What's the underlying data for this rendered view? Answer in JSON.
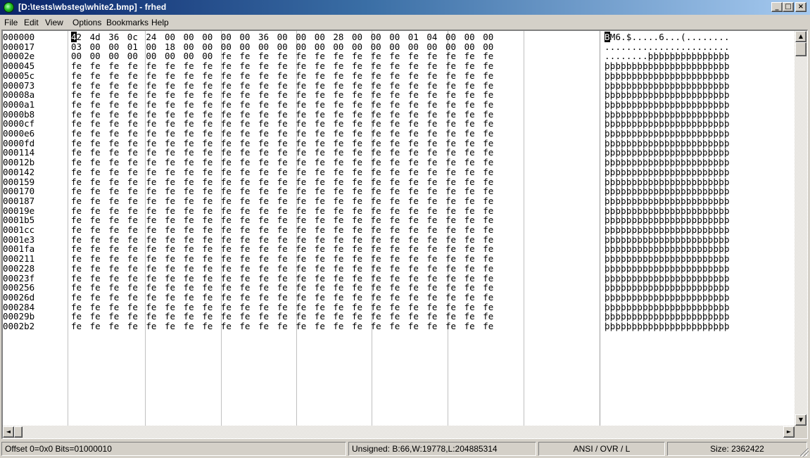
{
  "window": {
    "title": "[D:\\tests\\wbsteg\\white2.bmp] - frhed",
    "minimize_glyph": "_",
    "maximize_glyph": "□",
    "close_glyph": "×"
  },
  "menu": {
    "items": [
      {
        "label": "File",
        "accel": "F"
      },
      {
        "label": "Edit",
        "accel": "E"
      },
      {
        "label": "View",
        "accel": "V"
      },
      {
        "label": "Options",
        "accel": "O"
      },
      {
        "label": "Bookmarks",
        "accel": "B"
      },
      {
        "label": "Help",
        "accel": "H"
      }
    ]
  },
  "hex": {
    "bytes_per_row": 23,
    "cursor": {
      "row": 0,
      "col": 0
    },
    "rows": [
      {
        "offset": "000000",
        "bytes": [
          "42",
          "4d",
          "36",
          "0c",
          "24",
          "00",
          "00",
          "00",
          "00",
          "00",
          "36",
          "00",
          "00",
          "00",
          "28",
          "00",
          "00",
          "00",
          "01",
          "04",
          "00",
          "00",
          "00"
        ],
        "ascii": "BM6.$.....6...(........"
      },
      {
        "offset": "000017",
        "bytes": [
          "03",
          "00",
          "00",
          "01",
          "00",
          "18",
          "00",
          "00",
          "00",
          "00",
          "00",
          "00",
          "00",
          "00",
          "00",
          "00",
          "00",
          "00",
          "00",
          "00",
          "00",
          "00",
          "00"
        ],
        "ascii": "......................."
      },
      {
        "offset": "00002e",
        "bytes": [
          "00",
          "00",
          "00",
          "00",
          "00",
          "00",
          "00",
          "00",
          "fe",
          "fe",
          "fe",
          "fe",
          "fe",
          "fe",
          "fe",
          "fe",
          "fe",
          "fe",
          "fe",
          "fe",
          "fe",
          "fe",
          "fe"
        ],
        "ascii": "........þþþþþþþþþþþþþþþ"
      },
      {
        "offset": "000045",
        "fill": "fe",
        "ascii": "þþþþþþþþþþþþþþþþþþþþþþþ"
      },
      {
        "offset": "00005c",
        "fill": "fe",
        "ascii": "þþþþþþþþþþþþþþþþþþþþþþþ"
      },
      {
        "offset": "000073",
        "fill": "fe",
        "ascii": "þþþþþþþþþþþþþþþþþþþþþþþ"
      },
      {
        "offset": "00008a",
        "fill": "fe",
        "ascii": "þþþþþþþþþþþþþþþþþþþþþþþ"
      },
      {
        "offset": "0000a1",
        "fill": "fe",
        "ascii": "þþþþþþþþþþþþþþþþþþþþþþþ"
      },
      {
        "offset": "0000b8",
        "fill": "fe",
        "ascii": "þþþþþþþþþþþþþþþþþþþþþþþ"
      },
      {
        "offset": "0000cf",
        "fill": "fe",
        "ascii": "þþþþþþþþþþþþþþþþþþþþþþþ"
      },
      {
        "offset": "0000e6",
        "fill": "fe",
        "ascii": "þþþþþþþþþþþþþþþþþþþþþþþ"
      },
      {
        "offset": "0000fd",
        "fill": "fe",
        "ascii": "þþþþþþþþþþþþþþþþþþþþþþþ"
      },
      {
        "offset": "000114",
        "fill": "fe",
        "ascii": "þþþþþþþþþþþþþþþþþþþþþþþ"
      },
      {
        "offset": "00012b",
        "fill": "fe",
        "ascii": "þþþþþþþþþþþþþþþþþþþþþþþ"
      },
      {
        "offset": "000142",
        "fill": "fe",
        "ascii": "þþþþþþþþþþþþþþþþþþþþþþþ"
      },
      {
        "offset": "000159",
        "fill": "fe",
        "ascii": "þþþþþþþþþþþþþþþþþþþþþþþ"
      },
      {
        "offset": "000170",
        "fill": "fe",
        "ascii": "þþþþþþþþþþþþþþþþþþþþþþþ"
      },
      {
        "offset": "000187",
        "fill": "fe",
        "ascii": "þþþþþþþþþþþþþþþþþþþþþþþ"
      },
      {
        "offset": "00019e",
        "fill": "fe",
        "ascii": "þþþþþþþþþþþþþþþþþþþþþþþ"
      },
      {
        "offset": "0001b5",
        "fill": "fe",
        "ascii": "þþþþþþþþþþþþþþþþþþþþþþþ"
      },
      {
        "offset": "0001cc",
        "fill": "fe",
        "ascii": "þþþþþþþþþþþþþþþþþþþþþþþ"
      },
      {
        "offset": "0001e3",
        "fill": "fe",
        "ascii": "þþþþþþþþþþþþþþþþþþþþþþþ"
      },
      {
        "offset": "0001fa",
        "fill": "fe",
        "ascii": "þþþþþþþþþþþþþþþþþþþþþþþ"
      },
      {
        "offset": "000211",
        "fill": "fe",
        "ascii": "þþþþþþþþþþþþþþþþþþþþþþþ"
      },
      {
        "offset": "000228",
        "fill": "fe",
        "ascii": "þþþþþþþþþþþþþþþþþþþþþþþ"
      },
      {
        "offset": "00023f",
        "fill": "fe",
        "ascii": "þþþþþþþþþþþþþþþþþþþþþþþ"
      },
      {
        "offset": "000256",
        "fill": "fe",
        "ascii": "þþþþþþþþþþþþþþþþþþþþþþþ"
      },
      {
        "offset": "00026d",
        "fill": "fe",
        "ascii": "þþþþþþþþþþþþþþþþþþþþþþþ"
      },
      {
        "offset": "000284",
        "fill": "fe",
        "ascii": "þþþþþþþþþþþþþþþþþþþþþþþ"
      },
      {
        "offset": "00029b",
        "fill": "fe",
        "ascii": "þþþþþþþþþþþþþþþþþþþþþþþ"
      },
      {
        "offset": "0002b2",
        "fill": "fe",
        "ascii": "þþþþþþþþþþþþþþþþþþþþþþþ"
      }
    ]
  },
  "scrollbars": {
    "vertical": {
      "up_glyph": "▲",
      "down_glyph": "▼"
    },
    "horizontal": {
      "left_glyph": "◄",
      "right_glyph": "►"
    }
  },
  "status": {
    "offset": "Offset 0=0x0  Bits=01000010",
    "unsigned": "Unsigned: B:66,W:19778,L:204885314",
    "mode": "ANSI / OVR / L",
    "size": "Size: 2362422"
  }
}
